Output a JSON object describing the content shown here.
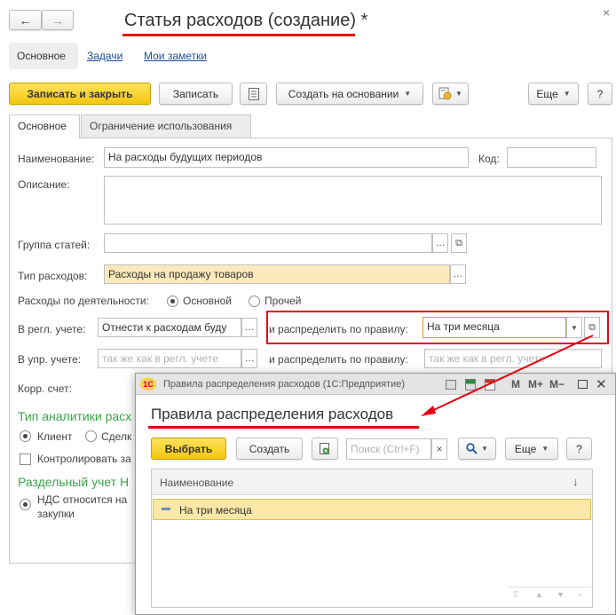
{
  "nav": {
    "back": "←",
    "forward": "→"
  },
  "title": "Статья расходов (создание) *",
  "close": "×",
  "sections": {
    "main": "Основное",
    "tasks": "Задачи",
    "notes": "Мои заметки"
  },
  "toolbar": {
    "save_close": "Записать и закрыть",
    "save": "Записать",
    "create_based": "Создать на основании",
    "more": "Еще",
    "help": "?"
  },
  "tabs": [
    "Основное",
    "Ограничение использования"
  ],
  "form": {
    "name_label": "Наименование:",
    "name_value": "На расходы будущих периодов",
    "code_label": "Код:",
    "code_value": "",
    "desc_label": "Описание:",
    "group_label": "Группа статей:",
    "type_label": "Тип расходов:",
    "type_value": "Расходы на продажу товаров",
    "activity_label": "Расходы по деятельности:",
    "activity_main": "Основной",
    "activity_other": "Прочей",
    "reg_label": "В регл. учете:",
    "reg_value": "Отнести к расходам буду",
    "distrib_label": "и распределить по правилу:",
    "distrib_value": "На три месяца",
    "mgmt_label": "В упр. учете:",
    "mgmt_placeholder": "так же как в регл. учете",
    "distrib2_label": "и распределить по правилу:",
    "distrib2_placeholder": "так же как в регл. учете",
    "corr_label": "Корр. счет:",
    "analytics_title": "Тип аналитики расх",
    "radio_client": "Клиент",
    "radio_deal": "Сделк",
    "control_label": "Контролировать за",
    "vat_title": "Раздельный учет Н",
    "vat_text1": "НДС относится на",
    "vat_text2": "закупки"
  },
  "popup": {
    "app_icon": "1С",
    "window_title": "Правила распределения расходов (1С:Предприятие)",
    "wm_m": "M",
    "wm_mplus": "M+",
    "wm_mminus": "M−",
    "heading": "Правила распределения расходов",
    "select_btn": "Выбрать",
    "create_btn": "Создать",
    "search_placeholder": "Поиск (Ctrl+F)",
    "search_clear": "×",
    "more_btn": "Еще",
    "help_btn": "?",
    "col_name": "Наименование",
    "sort_arrow": "↓",
    "row_value": "На три месяца"
  },
  "colors": {
    "accent_yellow": "#f4c712",
    "annotation_red": "#e30613",
    "green_heading": "#3aa64a"
  }
}
